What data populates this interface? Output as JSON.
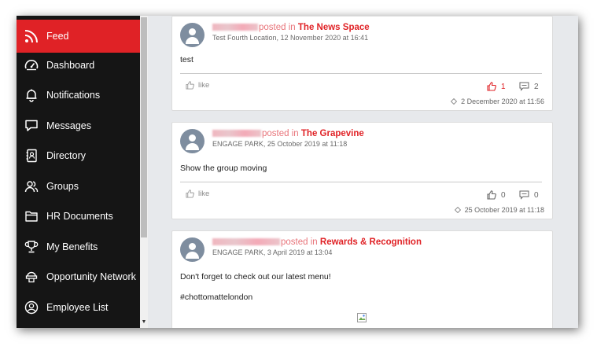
{
  "sidebar": {
    "items": [
      {
        "label": "Feed",
        "icon": "rss-icon",
        "active": true
      },
      {
        "label": "Dashboard",
        "icon": "speedometer-icon"
      },
      {
        "label": "Notifications",
        "icon": "bell-icon"
      },
      {
        "label": "Messages",
        "icon": "chat-icon"
      },
      {
        "label": "Directory",
        "icon": "contact-book-icon"
      },
      {
        "label": "Groups",
        "icon": "users-icon"
      },
      {
        "label": "HR Documents",
        "icon": "folder-icon"
      },
      {
        "label": "My Benefits",
        "icon": "trophy-icon"
      },
      {
        "label": "Opportunity Network",
        "icon": "network-icon"
      },
      {
        "label": "Employee List",
        "icon": "user-circle-icon"
      }
    ]
  },
  "posts": [
    {
      "posted_in": "posted in",
      "group": "The News Space",
      "meta": "Test Fourth Location, 12 November 2020 at 16:41",
      "body": [
        "test"
      ],
      "like_label": "like",
      "likes": "1",
      "comments": "2",
      "updated": "2 December 2020 at 11:56"
    },
    {
      "posted_in": "posted in",
      "group": "The Grapevine",
      "meta": "ENGAGE PARK, 25 October 2019 at 11:18",
      "body": [
        "Show the group moving"
      ],
      "like_label": "like",
      "likes": "0",
      "comments": "0",
      "updated": "25 October 2019 at 11:18"
    },
    {
      "posted_in": "posted in",
      "group": "Rewards & Recognition",
      "meta": "ENGAGE PARK, 3 April 2019 at 13:04",
      "body": [
        "Don't forget to check out our latest menu!",
        "#chottomattelondon"
      ]
    }
  ],
  "colors": {
    "accent": "#e02226",
    "sidebar_bg": "#151515",
    "content_bg": "#e7e9ec"
  }
}
